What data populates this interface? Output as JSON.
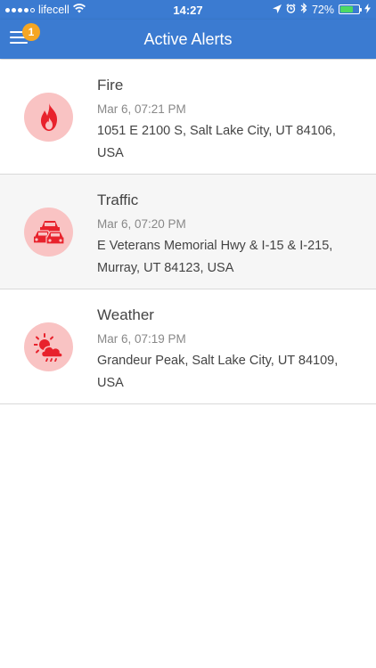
{
  "status_bar": {
    "carrier": "lifecell",
    "time": "14:27",
    "battery": "72%",
    "battery_level": 0.72,
    "signal_bars": 4,
    "icons": [
      "signal-dots-icon",
      "wifi-icon",
      "location-arrow-icon",
      "alarm-icon",
      "bluetooth-icon",
      "battery-icon",
      "charging-icon"
    ]
  },
  "header": {
    "title": "Active Alerts",
    "notification_count": "1",
    "menu_icon": "hamburger-menu-icon"
  },
  "colors": {
    "header_bg": "#3b7bd1",
    "badge": "#f5a623",
    "icon_circle": "#f9c3c3",
    "icon_glyph": "#e8222c"
  },
  "alerts": [
    {
      "title": "Fire",
      "time": "Mar 6, 07:21 PM",
      "address": "1051 E 2100 S, Salt Lake City, UT 84106, USA",
      "icon": "fire-icon"
    },
    {
      "title": "Traffic",
      "time": "Mar 6, 07:20 PM",
      "address": "E Veterans Memorial Hwy & I-15 & I-215, Murray, UT 84123, USA",
      "icon": "traffic-cars-icon"
    },
    {
      "title": "Weather",
      "time": "Mar 6, 07:19 PM",
      "address": "Grandeur Peak, Salt Lake City, UT 84109, USA",
      "icon": "weather-sun-cloud-icon"
    }
  ]
}
